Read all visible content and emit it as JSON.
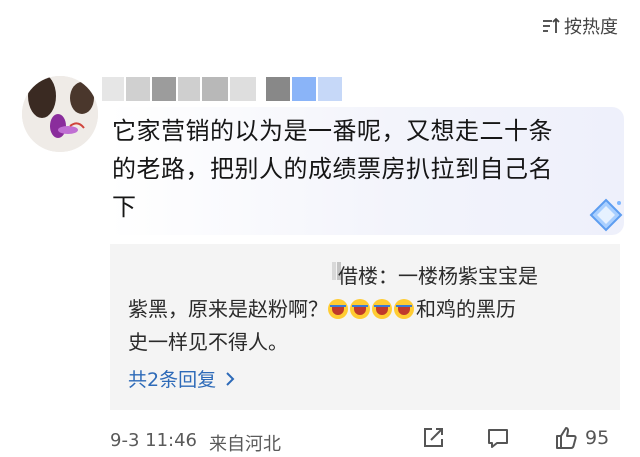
{
  "sort": {
    "label": "按热度",
    "icon": "sort-icon"
  },
  "comment": {
    "avatar_icon": "user-avatar",
    "text_lines": [
      "它家营销的以为是一番呢，又想走二十条",
      "的老路，把别人的成绩票房扒拉到自己名",
      "下"
    ],
    "badge_icon": "diamond-badge-icon"
  },
  "reply": {
    "prefix": "借楼：一楼杨紫宝宝是",
    "line2_text": "紫黑，原来是赵粉啊？",
    "line2_suffix": "和鸡的黑历",
    "line3": "史一样见不得人。",
    "emoji_count": 4,
    "emoji_icon": "crying-emoji"
  },
  "view_replies": {
    "label": "共2条回复",
    "icon": "chevron-right-icon"
  },
  "footer": {
    "date": "9-3 11:46",
    "location": "来自河北",
    "like_count": "95",
    "icons": [
      "share-icon",
      "comment-icon",
      "like-icon"
    ]
  },
  "colors": {
    "link": "#2d6ab8",
    "reply_bg": "#f4f4f4",
    "meta": "#5a5a5a"
  }
}
